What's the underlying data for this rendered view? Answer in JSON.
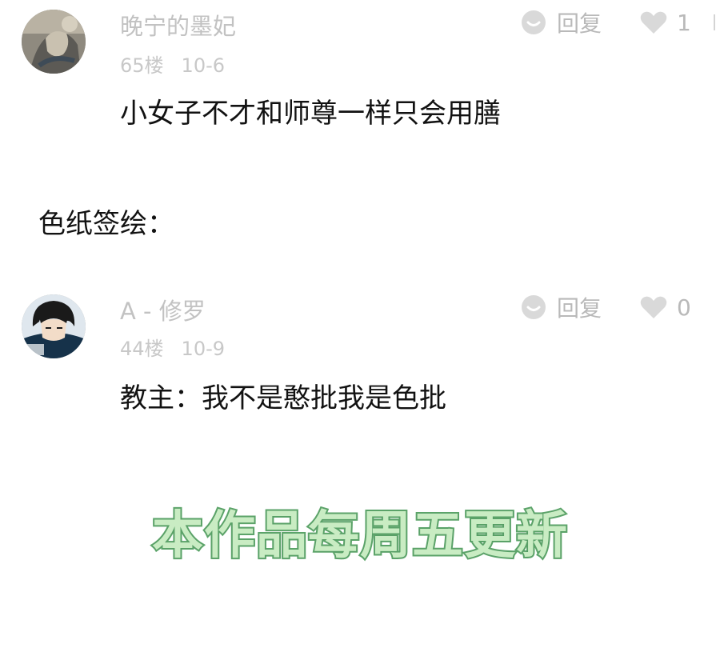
{
  "comments": [
    {
      "username": "晚宁的墨妃",
      "floor": "65楼",
      "date": "10-6",
      "reply_label": "回复",
      "like_count": "1",
      "text": "小女子不才和师尊一样只会用膳"
    },
    {
      "username": "A - 修罗",
      "floor": "44楼",
      "date": "10-9",
      "reply_label": "回复",
      "like_count": "0",
      "text": "教主：我不是憨批我是色批"
    }
  ],
  "section_label": "色纸签绘：",
  "banner": "本作品每周五更新",
  "colors": {
    "muted_text": "#c2c2c2",
    "icon_gray": "#d9d9d9",
    "banner_fill": "#c9ecc3",
    "banner_stroke": "#5ea56b"
  },
  "icons": {
    "reply": "chat-bubble-icon",
    "like": "heart-icon"
  }
}
